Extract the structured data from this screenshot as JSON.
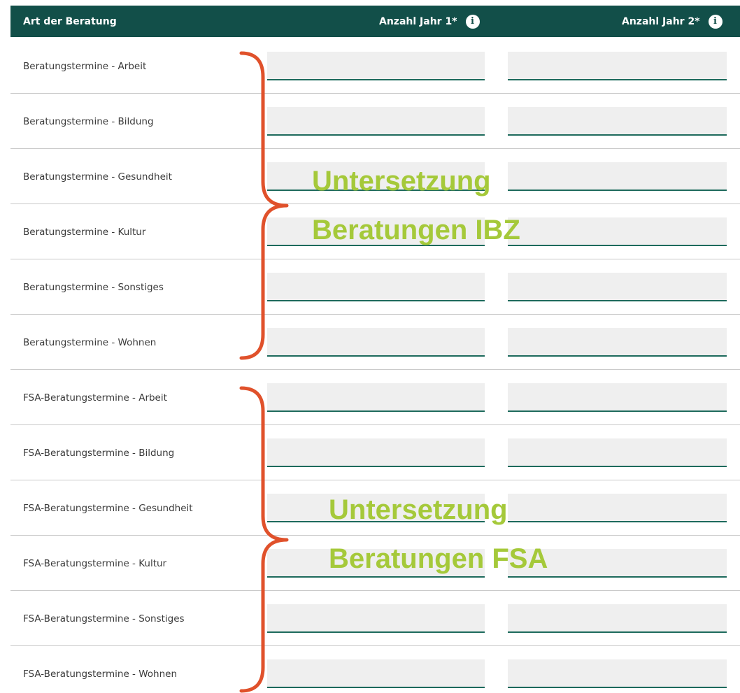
{
  "header": {
    "col_type": "Art der Beratung",
    "col_year1": "Anzahl Jahr 1*",
    "col_year2": "Anzahl Jahr 2*",
    "info_glyph": "i"
  },
  "rows": [
    {
      "label": "Beratungstermine - Arbeit",
      "year1": "",
      "year2": ""
    },
    {
      "label": "Beratungstermine - Bildung",
      "year1": "",
      "year2": ""
    },
    {
      "label": "Beratungstermine - Gesundheit",
      "year1": "",
      "year2": ""
    },
    {
      "label": "Beratungstermine - Kultur",
      "year1": "",
      "year2": ""
    },
    {
      "label": "Beratungstermine - Sonstiges",
      "year1": "",
      "year2": ""
    },
    {
      "label": "Beratungstermine - Wohnen",
      "year1": "",
      "year2": ""
    },
    {
      "label": "FSA-Beratungstermine - Arbeit",
      "year1": "",
      "year2": ""
    },
    {
      "label": "FSA-Beratungstermine - Bildung",
      "year1": "",
      "year2": ""
    },
    {
      "label": "FSA-Beratungstermine - Gesundheit",
      "year1": "",
      "year2": ""
    },
    {
      "label": "FSA-Beratungstermine - Kultur",
      "year1": "",
      "year2": ""
    },
    {
      "label": "FSA-Beratungstermine - Sonstiges",
      "year1": "",
      "year2": ""
    },
    {
      "label": "FSA-Beratungstermine - Wohnen",
      "year1": "",
      "year2": ""
    }
  ],
  "annotations": {
    "ibz": {
      "line1": "Untersetzung",
      "line2": "Beratungen IBZ"
    },
    "fsa": {
      "line1": "Untersetzung",
      "line2": "Beratungen FSA"
    }
  },
  "colors": {
    "header_bg": "#124f49",
    "input_bg": "#efefef",
    "input_underline": "#1d6a5c",
    "annotation_text": "#a5c93a",
    "brace": "#e0512b"
  }
}
